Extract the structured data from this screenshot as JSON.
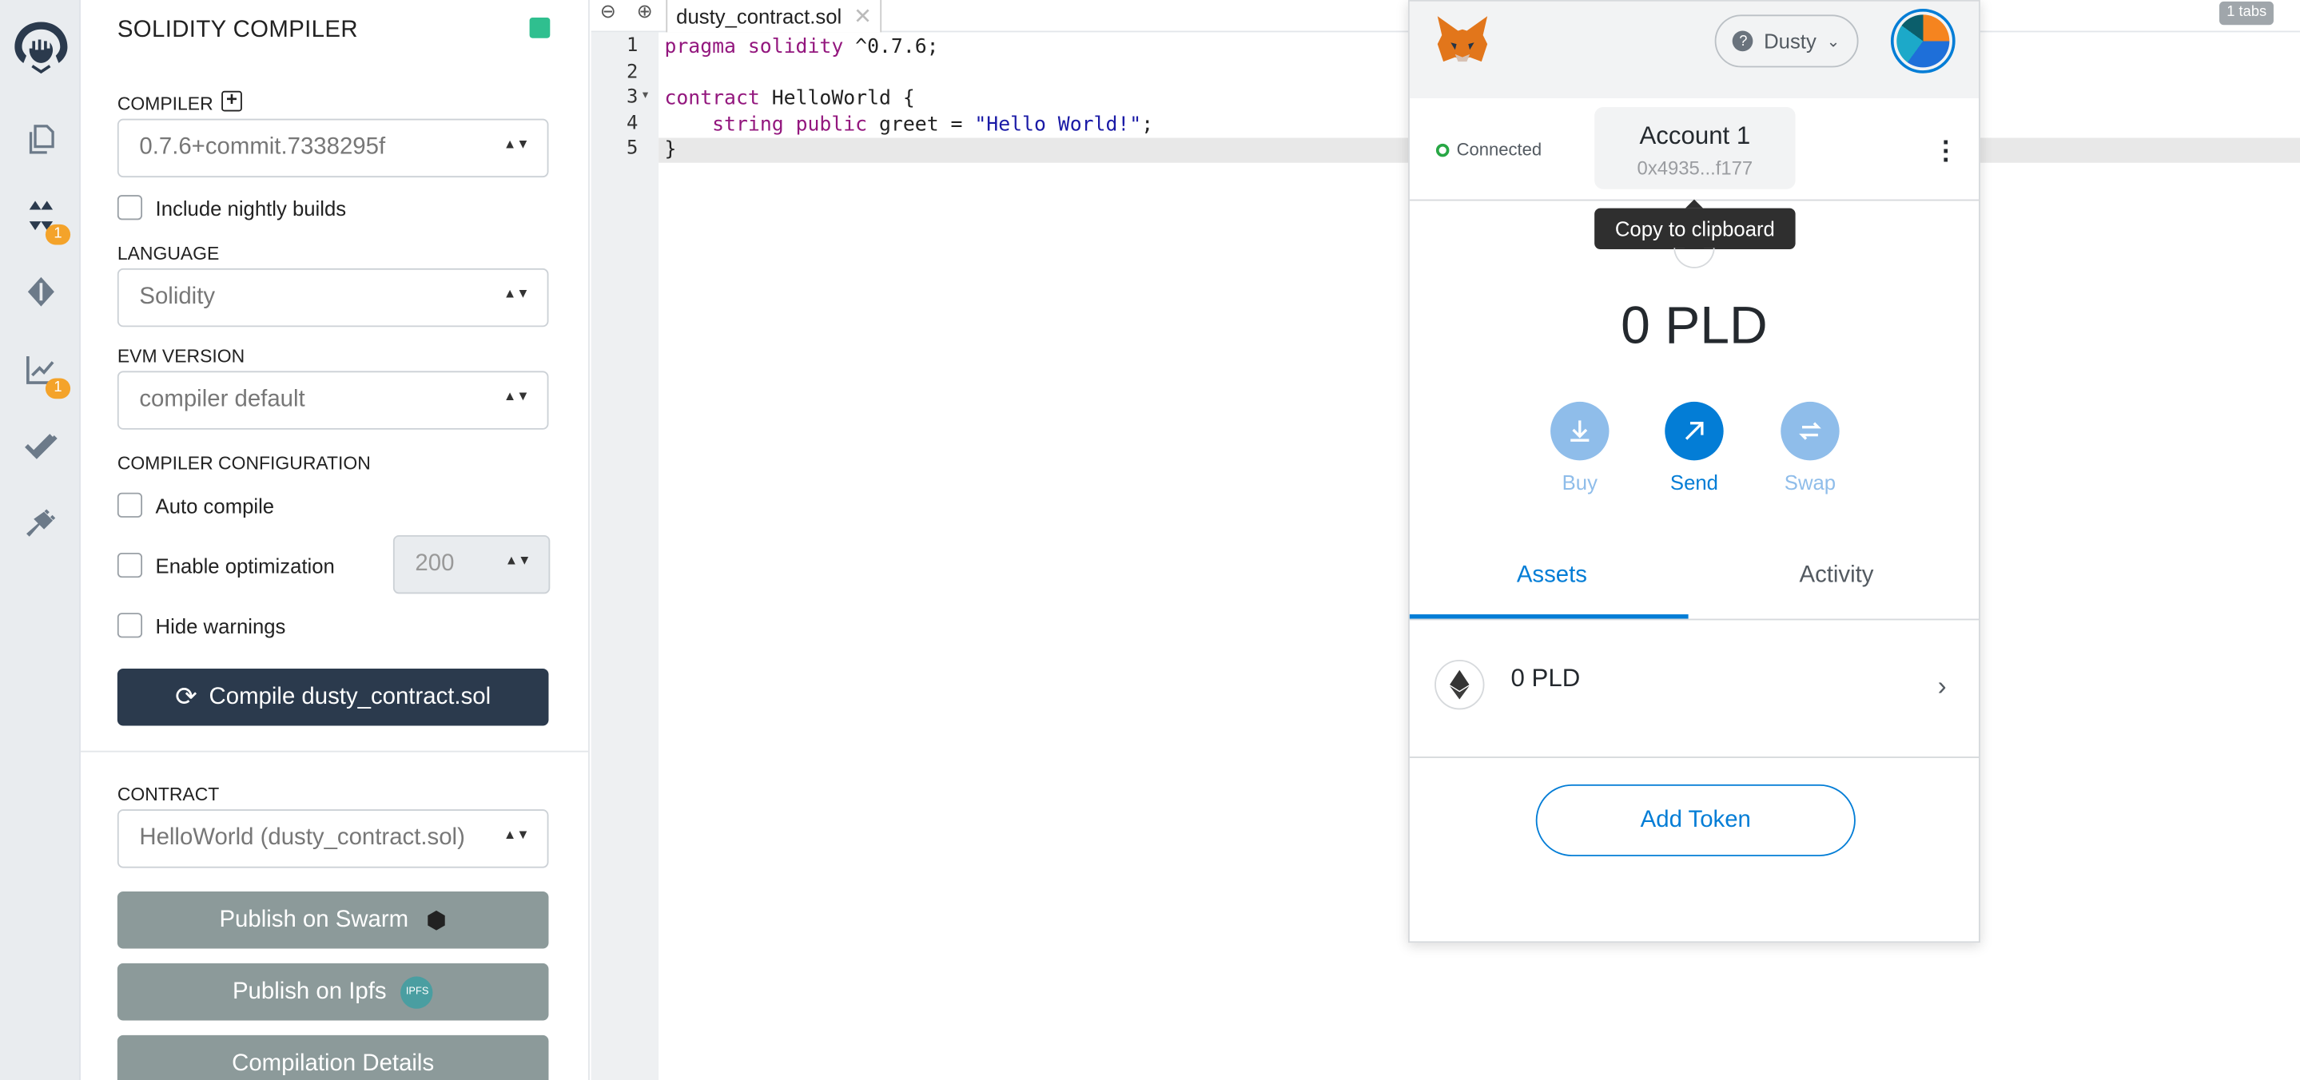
{
  "iconbar": {
    "items": [
      {
        "icon": "remix-logo-icon"
      },
      {
        "icon": "file-explorer-icon"
      },
      {
        "icon": "solidity-compiler-icon",
        "badge": "1"
      },
      {
        "icon": "deploy-run-icon"
      },
      {
        "icon": "analysis-icon",
        "badge": "1"
      },
      {
        "icon": "unit-testing-icon"
      },
      {
        "icon": "plugin-manager-icon"
      }
    ]
  },
  "compiler_panel": {
    "title": "SOLIDITY COMPILER",
    "compiler_label": "COMPILER",
    "compiler_value": "0.7.6+commit.7338295f",
    "nightly_label": "Include nightly builds",
    "language_label": "LANGUAGE",
    "language_value": "Solidity",
    "evm_label": "EVM VERSION",
    "evm_value": "compiler default",
    "config_label": "COMPILER CONFIGURATION",
    "auto_compile_label": "Auto compile",
    "optimization_label": "Enable optimization",
    "runs_value": "200",
    "hide_warnings_label": "Hide warnings",
    "compile_button": "Compile dusty_contract.sol",
    "contract_label": "CONTRACT",
    "contract_value": "HelloWorld (dusty_contract.sol)",
    "swarm_button": "Publish on Swarm",
    "ipfs_button": "Publish on Ipfs",
    "ipfs_logo_text": "IPFS",
    "details_button": "Compilation Details"
  },
  "editor": {
    "tab_name": "dusty_contract.sol",
    "tabs_count": "1 tabs",
    "line_numbers": [
      "1",
      "2",
      "3",
      "4",
      "5"
    ],
    "lines": {
      "l1_kw": "pragma solidity",
      "l1_rest": " ^0.7.6;",
      "l3_kw": "contract",
      "l3_rest": " HelloWorld {",
      "l4_indent": "    ",
      "l4_kw": "string public",
      "l4_mid": " greet = ",
      "l4_str": "\"Hello World!\"",
      "l4_end": ";",
      "l5": "}"
    }
  },
  "metamask": {
    "network": "Dusty",
    "status": "Connected",
    "account_name": "Account 1",
    "account_address": "0x4935...f177",
    "tooltip": "Copy to clipboard",
    "balance": "0 PLD",
    "actions": {
      "buy": "Buy",
      "send": "Send",
      "swap": "Swap"
    },
    "tabs": {
      "assets": "Assets",
      "activity": "Activity"
    },
    "asset_balance": "0 PLD",
    "add_token": "Add Token",
    "colors": {
      "primary": "#037dd6",
      "disabled": "#8fbdea",
      "fox": "#e2761b"
    }
  }
}
